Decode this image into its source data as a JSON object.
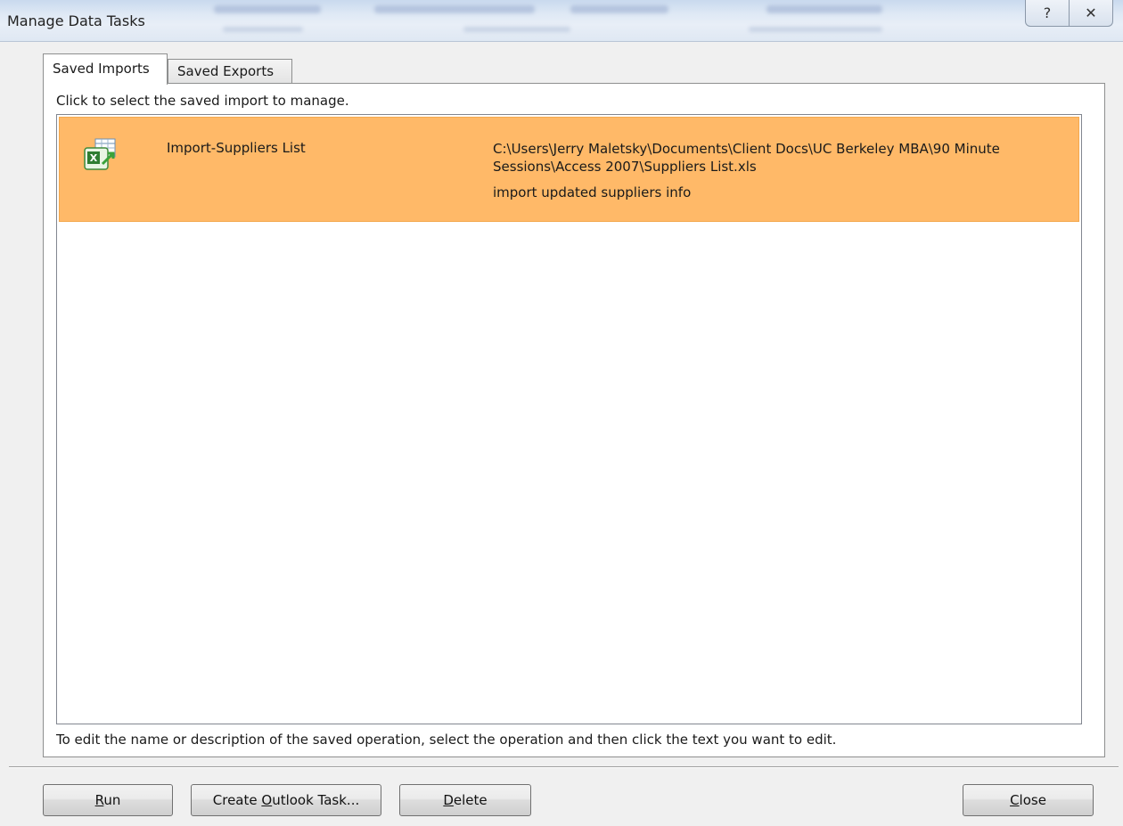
{
  "window": {
    "title": "Manage Data Tasks",
    "help_glyph": "?",
    "close_glyph": "✕"
  },
  "tabs": [
    {
      "label": "Saved Imports",
      "active": true
    },
    {
      "label": "Saved Exports",
      "active": false
    }
  ],
  "panel": {
    "instruction": "Click to select the saved import to manage.",
    "hint": "To edit the name or description of the saved operation, select the operation and then click the text you want to edit."
  },
  "items": [
    {
      "icon": "excel-import-icon",
      "name": "Import-Suppliers List",
      "path": "C:\\Users\\Jerry Maletsky\\Documents\\Client Docs\\UC Berkeley MBA\\90 Minute Sessions\\Access 2007\\Suppliers List.xls",
      "description": "import updated suppliers info",
      "selected": true
    }
  ],
  "buttons": {
    "run": {
      "pre": "",
      "accel": "R",
      "post": "un"
    },
    "outlook": {
      "pre": "Create ",
      "accel": "O",
      "post": "utlook Task..."
    },
    "delete": {
      "pre": "",
      "accel": "D",
      "post": "elete"
    },
    "close": {
      "pre": "",
      "accel": "C",
      "post": "lose"
    }
  },
  "colors": {
    "selected_row": "#ffb968",
    "dialog_bg": "#f0f0f0"
  }
}
